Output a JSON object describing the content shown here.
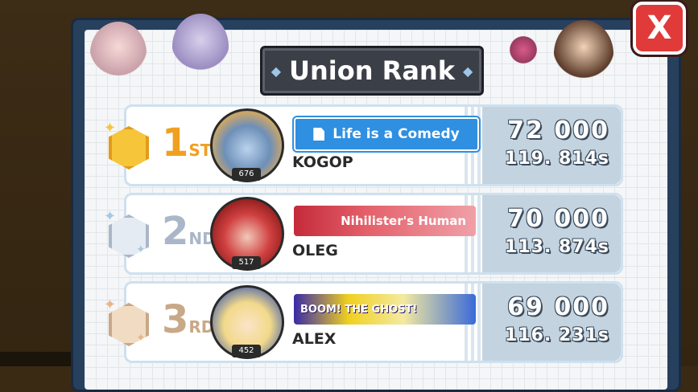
{
  "title": "Union Rank",
  "close_label": "X",
  "ranks": [
    {
      "place_num": "1",
      "place_suffix": "ST",
      "color": "#f0a020",
      "medal": "gold-medal-icon",
      "player": "KOGOP",
      "level": "676",
      "banner": "Life is a Comedy",
      "score": "72 000",
      "time": "119. 814s"
    },
    {
      "place_num": "2",
      "place_suffix": "ND",
      "color": "#a9b7c8",
      "medal": "silver-medal-icon",
      "player": "OLEG",
      "level": "517",
      "banner": "Nihilister's Human",
      "score": "70 000",
      "time": "113. 874s"
    },
    {
      "place_num": "3",
      "place_suffix": "RD",
      "color": "#c9a887",
      "medal": "bronze-medal-icon",
      "player": "ALEX",
      "level": "452",
      "banner": "BOOM! THE GHOST!",
      "score": "69 000",
      "time": "116. 231s"
    }
  ]
}
